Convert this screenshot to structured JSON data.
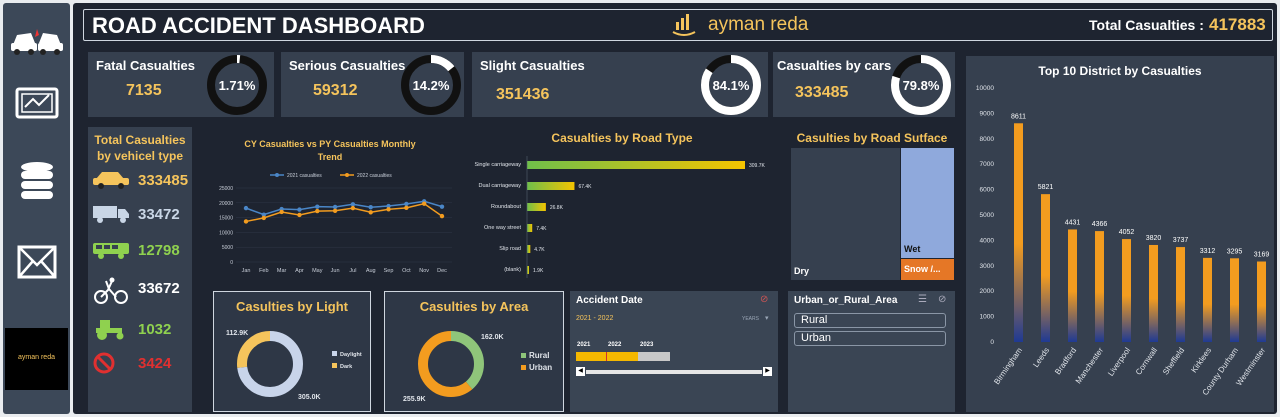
{
  "dashboard": {
    "title": "ROAD ACCIDENT DASHBOARD",
    "brand": "ayman reda",
    "total_label": "Total Casualties :",
    "total_value": "417883"
  },
  "sidebar": {
    "icons": [
      "car-crash-icon",
      "tablet-chart-icon",
      "database-icon",
      "mail-icon"
    ],
    "logo_text": "ayman reda"
  },
  "kpis": [
    {
      "label": "Fatal Casualties",
      "value": "7135",
      "pct": "1.71%",
      "fraction": 0.0171
    },
    {
      "label": "Serious Casualties",
      "value": "59312",
      "pct": "14.2%",
      "fraction": 0.142
    },
    {
      "label": "Slight Casualties",
      "value": "351436",
      "pct": "84.1%",
      "fraction": 0.841
    },
    {
      "label": "Casualties by cars",
      "value": "333485",
      "pct": "79.8%",
      "fraction": 0.798
    }
  ],
  "vehicles": {
    "title_line1": "Total Casualties",
    "title_line2": "by vehicel type",
    "rows": [
      {
        "icon": "taxi-icon",
        "value": "333485",
        "color": "#f5c45c"
      },
      {
        "icon": "truck-icon",
        "value": "33472",
        "color": "#c9d6e6"
      },
      {
        "icon": "bus-icon",
        "value": "12798",
        "color": "#8fd14f"
      },
      {
        "icon": "bicycle-icon",
        "value": "33672",
        "color": "#ffffff"
      },
      {
        "icon": "tractor-icon",
        "value": "1032",
        "color": "#8fd14f"
      },
      {
        "icon": "no-entry-icon",
        "value": "3424",
        "color": "#e03030"
      }
    ]
  },
  "chart_data": [
    {
      "type": "line",
      "title": "CY Casualties vs PY Casualties Monthly Trend",
      "categories": [
        "Jan",
        "Feb",
        "Mar",
        "Apr",
        "May",
        "Jun",
        "Jul",
        "Aug",
        "Sep",
        "Oct",
        "Nov",
        "Dec"
      ],
      "series": [
        {
          "name": "2021 casualties",
          "values": [
            18200,
            16000,
            17900,
            17700,
            18700,
            18600,
            19500,
            18500,
            18900,
            19600,
            20500,
            18700
          ],
          "color": "#4a86c7"
        },
        {
          "name": "2022 casualties",
          "values": [
            13700,
            14900,
            16900,
            15900,
            17200,
            17300,
            18200,
            16800,
            17800,
            18300,
            19700,
            15500
          ],
          "color": "#f39c1f"
        }
      ],
      "ylim": [
        0,
        25000
      ],
      "yticks": [
        "25000",
        "20000",
        "15000",
        "10000",
        "5000",
        "0"
      ]
    },
    {
      "type": "bar",
      "title": "Casualties by Road Type",
      "categories": [
        "Single carriageway",
        "Dual carriageway",
        "Roundabout",
        "One way street",
        "Slip road",
        "(blank)"
      ],
      "values": [
        309700,
        67400,
        26800,
        7400,
        4700,
        1900
      ],
      "data_labels": [
        "309.7K",
        "67.4K",
        "26.8K",
        "7.4K",
        "4.7K",
        "1.9K"
      ]
    },
    {
      "type": "area",
      "title": "Casulties by Road Sutface",
      "categories": [
        "Dry",
        "Wet",
        "Snow /..."
      ]
    },
    {
      "type": "bar",
      "title": "Top 10 District by Casualties",
      "categories": [
        "Birmingham",
        "Leeds",
        "Bradford",
        "Manchester",
        "Liverpool",
        "Cornwall",
        "Sheffield",
        "Kirklees",
        "County Durham",
        "Westminster"
      ],
      "values": [
        8611,
        5821,
        4431,
        4366,
        4052,
        3820,
        3737,
        3312,
        3295,
        3169
      ],
      "ylim": [
        0,
        10000
      ],
      "yticks": [
        "10000",
        "9000",
        "8000",
        "7000",
        "6000",
        "5000",
        "4000",
        "3000",
        "2000",
        "1000",
        "0"
      ]
    },
    {
      "type": "pie",
      "title": "Casulties by Light",
      "categories": [
        "Daylight",
        "Dark"
      ],
      "values": [
        305000,
        112900
      ],
      "data_labels": [
        "305.0K",
        "112.9K"
      ]
    },
    {
      "type": "pie",
      "title": "Casulties by Area",
      "categories": [
        "Rural",
        "Urban"
      ],
      "values": [
        162000,
        255900
      ],
      "data_labels": [
        "162.0K",
        "255.9K"
      ]
    }
  ],
  "timeline": {
    "title": "Accident Date",
    "range": "2021 - 2022",
    "unit": "YEARS",
    "years": [
      "2021",
      "2022",
      "2023"
    ]
  },
  "slicer": {
    "title": "Urban_or_Rural_Area",
    "options": [
      "Rural",
      "Urban"
    ]
  },
  "colors": {
    "accent": "#f5c45c",
    "orange": "#f39c1f",
    "navy": "#1f3a93",
    "blue": "#8fa9dc"
  }
}
